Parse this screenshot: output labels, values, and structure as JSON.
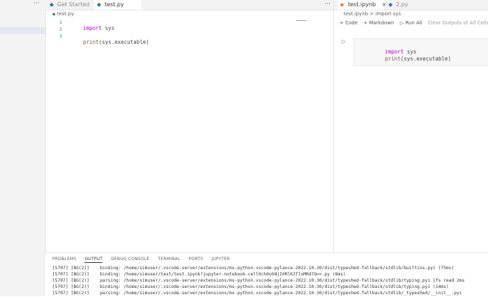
{
  "sidebar": {
    "more": "···"
  },
  "editor_left": {
    "tabs": [
      {
        "icon": "vscode-icon",
        "label": "Get Started"
      },
      {
        "icon": "python-icon",
        "label": "test.py"
      }
    ],
    "more": "···",
    "breadcrumb": "test.py",
    "gutter": [
      "1",
      "2",
      "3"
    ],
    "code": [
      {
        "kw": "import",
        "rest": " sys"
      },
      {
        "kw": "",
        "rest": ""
      },
      {
        "fn": "print",
        "rest": "(sys.executable)"
      }
    ]
  },
  "editor_right": {
    "tabs": [
      {
        "label": "test.ipynb",
        "close": "×"
      },
      {
        "label": "2.py"
      }
    ],
    "breadcrumb": "test.ipynb > import sys",
    "toolbar": [
      "+ Code",
      "+ Markdown",
      "▷ Run All",
      "Clear Outputs of All Cells"
    ],
    "run_glyph": "▷",
    "cell_code": [
      {
        "kw": "import",
        "rest": " sys"
      },
      {
        "fn": "print",
        "rest": "(sys.executable)"
      }
    ]
  },
  "panel": {
    "tabs": [
      "PROBLEMS",
      "OUTPUT",
      "DEBUG CONSOLE",
      "TERMINAL",
      "PORTS",
      "JUPYTER"
    ],
    "active_tab": "OUTPUT",
    "output": [
      "[5707] [BG(2)]    binding: /home/simuser/.vscode-server/extensions/ms-python.vscode-pylance-2022.10.30/dist/typeshed-fallback/stdlib/builtins.pyi (75ms)",
      "[5707] [BG(2)]    binding: /home/simuser/test/test.ipynb?jupyter-notebook-cell0ch0ohNjI0RlK3TlxMRd7Q==.py (8ms)",
      "[5707] [BG(2)]    parsing: /home/simuser/.vscode-server/extensions/ms-python.vscode-pylance-2022.10.30/dist/typeshed-fallback/stdlib/typing.pyi [fs read 2ms",
      "[5707] [BG(2)]    binding: /home/simuser/.vscode-server/extensions/ms-python.vscode-pylance-2022.10.30/dist/typeshed-fallback/stdlib/typing.pyi (14ms)",
      "[5707] [BG(2)]    parsing: /home/simuser/.vscode-server/extensions/ms-python.vscode-pylance-2022.10.30/dist/typeshed-fallback/stdlib/_typeshed/__init__.pyi"
    ]
  }
}
